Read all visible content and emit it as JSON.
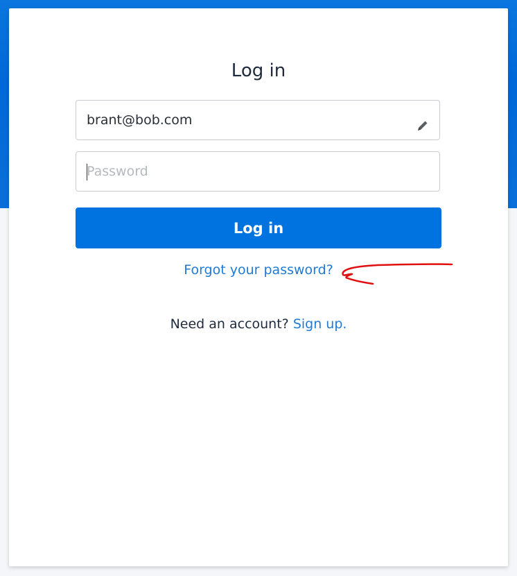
{
  "login": {
    "title": "Log in",
    "email_value": "brant@bob.com",
    "password_placeholder": "Password",
    "submit_label": "Log in",
    "forgot_label": "Forgot your password?",
    "signup_prompt": "Need an account?",
    "signup_label": "Sign up."
  },
  "theme": {
    "brand_blue": "#0073e0",
    "link_blue": "#1f7ad3",
    "annotation_red": "#e01010"
  },
  "icons": {
    "email_field_icon": "pencil-icon"
  }
}
